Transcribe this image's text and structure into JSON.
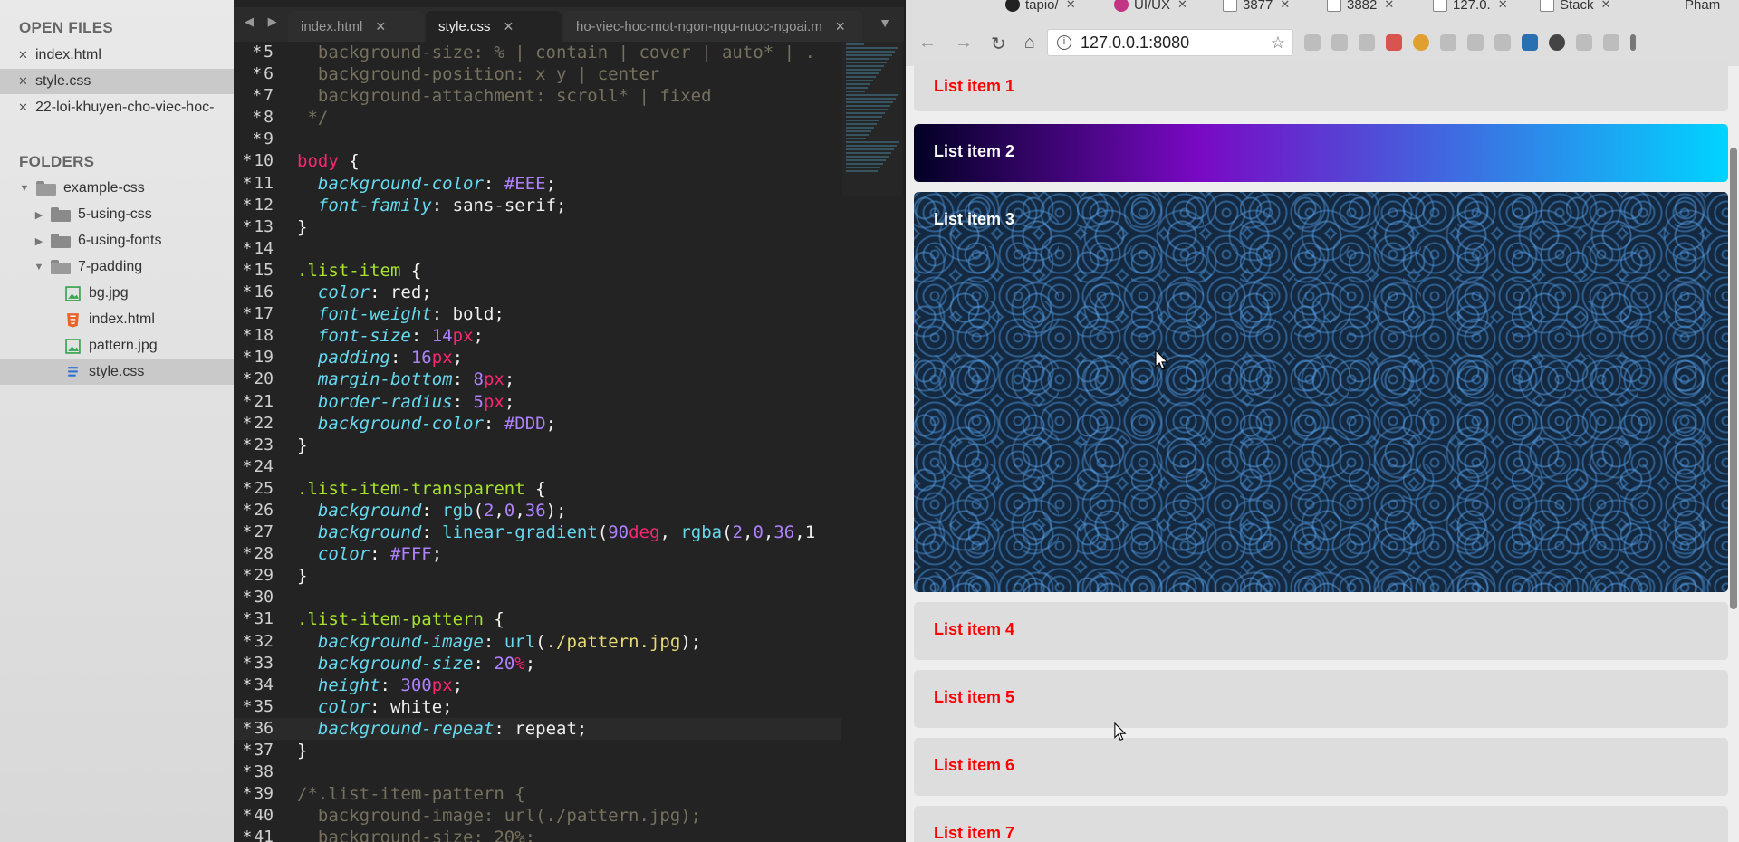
{
  "sidebar": {
    "open_files_title": "OPEN FILES",
    "open_files": [
      "index.html",
      "style.css",
      "22-loi-khuyen-cho-viec-hoc-"
    ],
    "folders_title": "FOLDERS",
    "tree": {
      "root": "example-css",
      "f1": "5-using-css",
      "f2": "6-using-fonts",
      "f3": "7-padding",
      "files": [
        "bg.jpg",
        "index.html",
        "pattern.jpg",
        "style.css"
      ]
    }
  },
  "editor": {
    "tabs": [
      "index.html",
      "style.css",
      "ho-viec-hoc-mot-ngon-ngu-nuoc-ngoai.m"
    ],
    "lines": [
      {
        "n": "5",
        "t": "  background-size: % | contain | cover | auto* | ."
      },
      {
        "n": "6",
        "t": "  background-position: x y | center"
      },
      {
        "n": "7",
        "t": "  background-attachment: scroll* | fixed"
      },
      {
        "n": "8",
        "t": " */"
      },
      {
        "n": "9",
        "t": ""
      },
      {
        "n": "10",
        "t": "body {"
      },
      {
        "n": "11",
        "t": "  background-color: #EEE;"
      },
      {
        "n": "12",
        "t": "  font-family: sans-serif;"
      },
      {
        "n": "13",
        "t": "}"
      },
      {
        "n": "14",
        "t": ""
      },
      {
        "n": "15",
        "t": ".list-item {"
      },
      {
        "n": "16",
        "t": "  color: red;"
      },
      {
        "n": "17",
        "t": "  font-weight: bold;"
      },
      {
        "n": "18",
        "t": "  font-size: 14px;"
      },
      {
        "n": "19",
        "t": "  padding: 16px;"
      },
      {
        "n": "20",
        "t": "  margin-bottom: 8px;"
      },
      {
        "n": "21",
        "t": "  border-radius: 5px;"
      },
      {
        "n": "22",
        "t": "  background-color: #DDD;"
      },
      {
        "n": "23",
        "t": "}"
      },
      {
        "n": "24",
        "t": ""
      },
      {
        "n": "25",
        "t": ".list-item-transparent {"
      },
      {
        "n": "26",
        "t": "  background: rgb(2,0,36);"
      },
      {
        "n": "27",
        "t": "  background: linear-gradient(90deg, rgba(2,0,36,1"
      },
      {
        "n": "28",
        "t": "  color: #FFF;"
      },
      {
        "n": "29",
        "t": "}"
      },
      {
        "n": "30",
        "t": ""
      },
      {
        "n": "31",
        "t": ".list-item-pattern {"
      },
      {
        "n": "32",
        "t": "  background-image: url(./pattern.jpg);"
      },
      {
        "n": "33",
        "t": "  background-size: 20%;"
      },
      {
        "n": "34",
        "t": "  height: 300px;"
      },
      {
        "n": "35",
        "t": "  color: white;"
      },
      {
        "n": "36",
        "t": "  background-repeat: repeat;"
      },
      {
        "n": "37",
        "t": "}"
      },
      {
        "n": "38",
        "t": ""
      },
      {
        "n": "39",
        "t": "/*.list-item-pattern {"
      },
      {
        "n": "40",
        "t": "  background-image: url(./pattern.jpg);"
      },
      {
        "n": "41",
        "t": "  background-size: 20%;"
      }
    ]
  },
  "browser": {
    "tabs": [
      "tapio/",
      "UI/UX",
      "3877",
      "3882",
      "127.0.",
      "Stack",
      "Pham"
    ],
    "url": "127.0.0.1:8080",
    "items": [
      "List item 1",
      "List item 2",
      "List item 3",
      "List item 4",
      "List item 5",
      "List item 6",
      "List item 7"
    ]
  },
  "colors": {
    "list_item_text": "#ff0000",
    "list_item_bg": "#dddddd",
    "page_bg": "#eeeeee"
  }
}
